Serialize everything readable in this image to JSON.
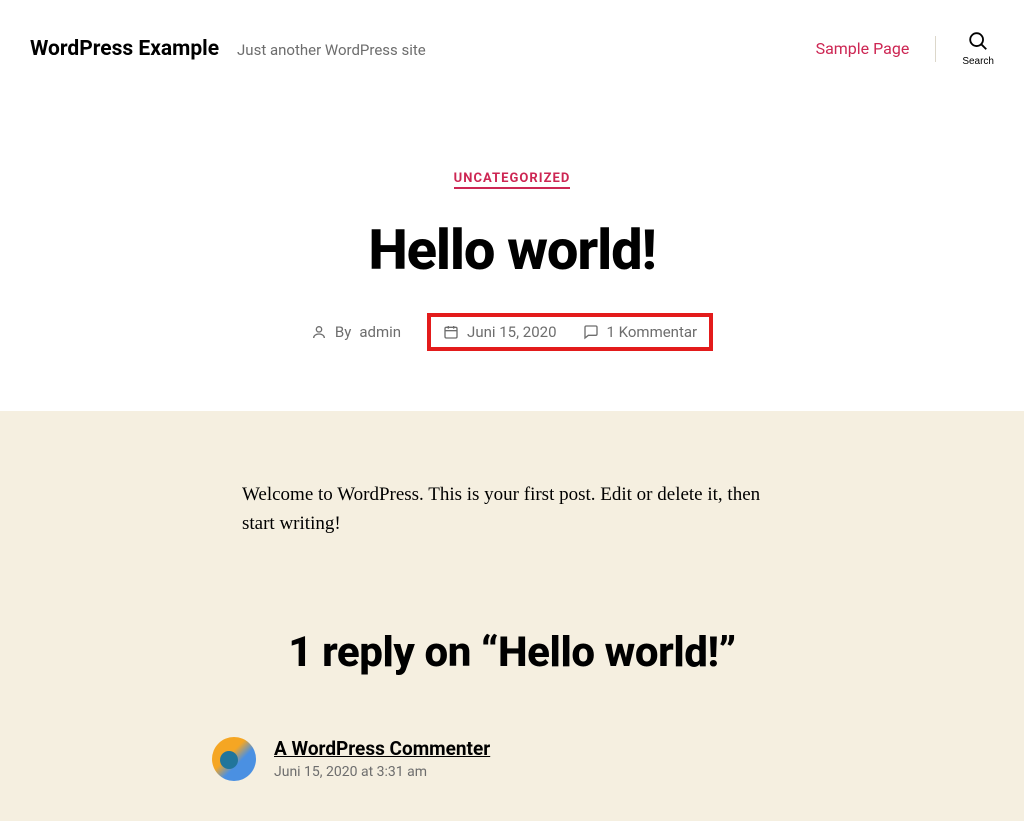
{
  "header": {
    "site_title": "WordPress Example",
    "tagline": "Just another WordPress site",
    "nav_link": "Sample Page",
    "search_label": "Search"
  },
  "post": {
    "category": "UNCATEGORIZED",
    "title": "Hello world!",
    "meta": {
      "by_prefix": "By",
      "author": "admin",
      "date": "Juni 15, 2020",
      "comments": "1 Kommentar"
    },
    "content": "Welcome to WordPress. This is your first post. Edit or delete it, then start writing!"
  },
  "comments": {
    "heading": "1 reply on “Hello world!”",
    "first": {
      "author": "A WordPress Commenter",
      "date": "Juni 15, 2020 at 3:31 am"
    }
  }
}
